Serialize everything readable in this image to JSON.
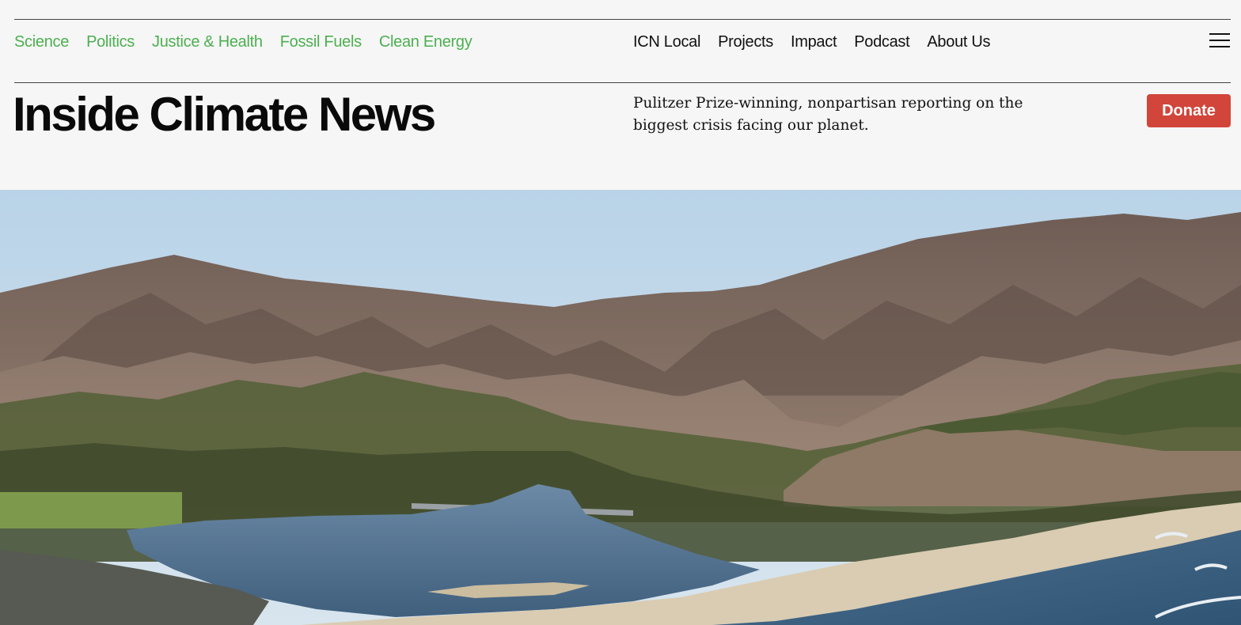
{
  "site": {
    "name": "Inside Climate News",
    "tagline": "Pulitzer Prize-winning, nonpartisan reporting on the biggest crisis facing our planet."
  },
  "nav": {
    "sections": [
      "Science",
      "Politics",
      "Justice & Health",
      "Fossil Fuels",
      "Clean Energy"
    ],
    "links": [
      "ICN Local",
      "Projects",
      "Impact",
      "Podcast",
      "About Us"
    ]
  },
  "actions": {
    "donate_label": "Donate"
  },
  "icons": {
    "menu": "hamburger-menu-icon"
  },
  "colors": {
    "section_link": "#4caf50",
    "donate": "#d1453b",
    "background": "#f6f6f6",
    "sky": "#c9dcea",
    "mountain": "#7e6c62",
    "water": "#4f6f8c",
    "sand": "#d9ccb2",
    "vegetation": "#4c5a34"
  },
  "hero_image": {
    "subject": "aerial view of a coastal lagoon, beach and mountains"
  }
}
